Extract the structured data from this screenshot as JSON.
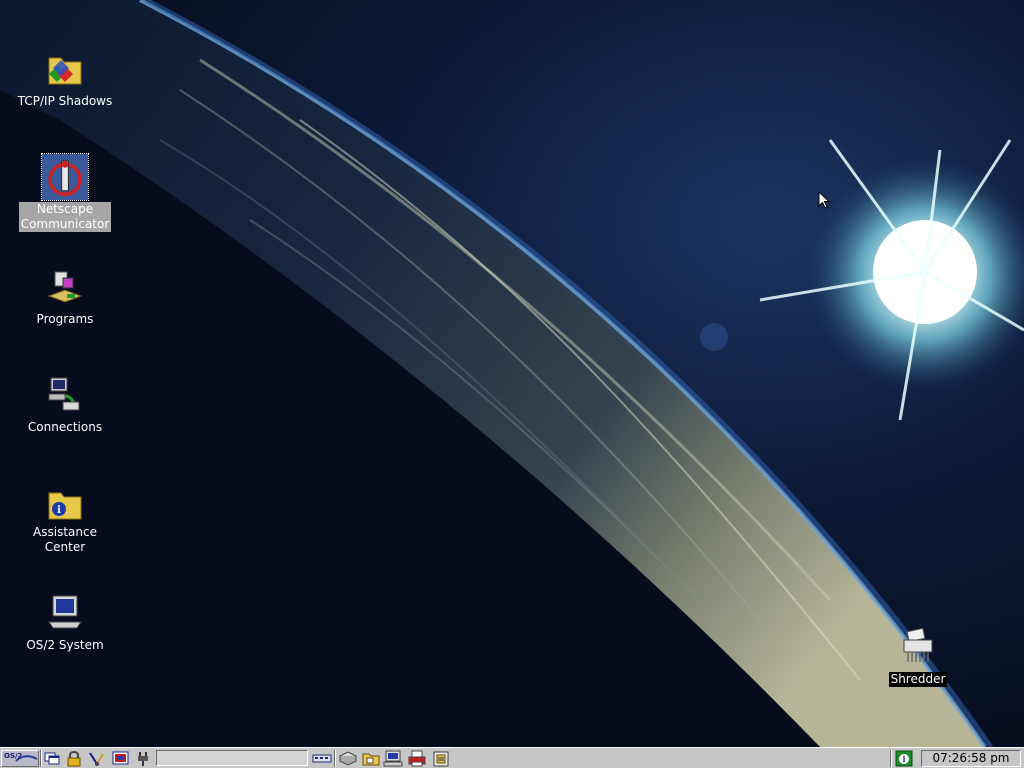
{
  "desktop": {
    "icons": [
      {
        "name": "tcpip-shadows",
        "label": "TCP/IP Shadows",
        "icon": "folder-shadow-icon"
      },
      {
        "name": "netscape-communicator",
        "label": "Netscape\nCommunicator",
        "icon": "netscape-icon",
        "selected": true
      },
      {
        "name": "programs",
        "label": "Programs",
        "icon": "programs-icon"
      },
      {
        "name": "connections",
        "label": "Connections",
        "icon": "connections-icon"
      },
      {
        "name": "assistance-center",
        "label": "Assistance Center",
        "icon": "info-folder-icon"
      },
      {
        "name": "os2-system",
        "label": "OS/2 System",
        "icon": "computer-icon"
      },
      {
        "name": "shredder",
        "label": "Shredder",
        "icon": "shredder-icon"
      }
    ]
  },
  "taskbar": {
    "logo_text": "OS/2",
    "clock": "07:26:58 pm",
    "buttons": [
      "window-list-icon",
      "lock-icon",
      "find-icon",
      "system-setup-icon",
      "power-icon",
      "keyboard-icon",
      "drives-icon",
      "folder-tools-icon",
      "network-icon",
      "printer-icon",
      "clipboard-icon",
      "help-icon"
    ]
  }
}
